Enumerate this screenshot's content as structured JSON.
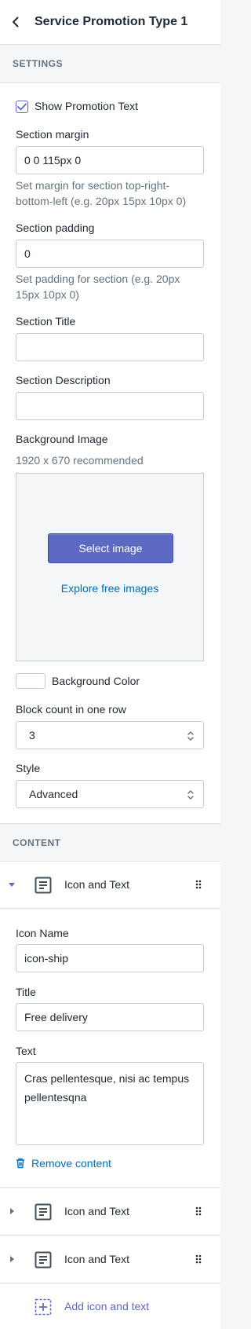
{
  "header": {
    "title": "Service Promotion Type 1",
    "back_icon": "chevron-left-icon"
  },
  "settings": {
    "section_label": "SETTINGS",
    "show_promotion_text": {
      "label": "Show Promotion Text",
      "checked": true
    },
    "section_margin": {
      "label": "Section margin",
      "value": "0 0 115px 0",
      "help": [
        "Set margin for section top-right-",
        "bottom-left (e.g. 20px 15px 10px 0)"
      ]
    },
    "section_padding": {
      "label": "Section padding",
      "value": "0",
      "help": [
        "Set padding for section (e.g. 20px",
        "15px 10px 0)"
      ]
    },
    "section_title": {
      "label": "Section Title",
      "value": ""
    },
    "section_description": {
      "label": "Section Description",
      "value": ""
    },
    "background_image": {
      "label": "Background Image",
      "help": "1920 x 670 recommended",
      "select_button": "Select image",
      "explore_link": "Explore free images"
    },
    "background_color": {
      "label": "Background Color",
      "value": "#ffffff"
    },
    "block_count": {
      "label": "Block count in one row",
      "value": "3"
    },
    "style": {
      "label": "Style",
      "value": "Advanced"
    }
  },
  "content": {
    "section_label": "CONTENT",
    "blocks": [
      {
        "name": "Icon and Text",
        "expanded": true
      },
      {
        "name": "Icon and Text",
        "expanded": false
      },
      {
        "name": "Icon and Text",
        "expanded": false
      }
    ],
    "expanded_block": {
      "icon_name": {
        "label": "Icon Name",
        "value": "icon-ship"
      },
      "title": {
        "label": "Title",
        "value": "Free delivery"
      },
      "text": {
        "label": "Text",
        "value": "Cras pellentesque, nisi ac tempus pellentesqna"
      },
      "remove_label": "Remove content"
    },
    "add_label": "Add icon and text"
  },
  "colors": {
    "accent": "#5c6ac4",
    "link": "#006fbb",
    "border": "#c4cdd5",
    "muted_text": "#637381"
  }
}
